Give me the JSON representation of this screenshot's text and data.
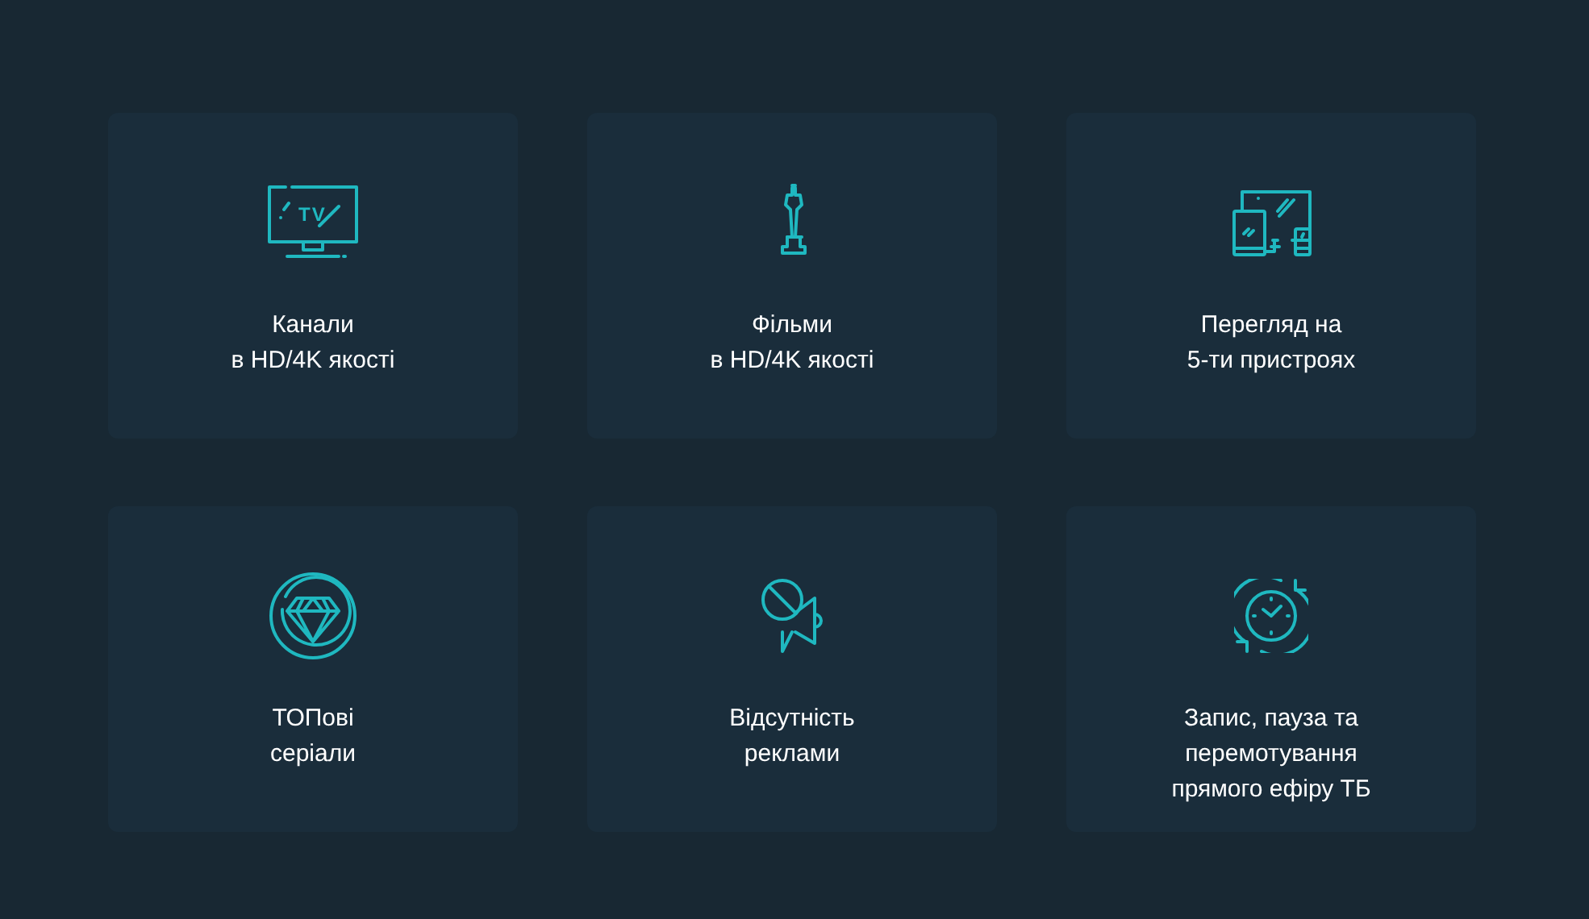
{
  "features": [
    {
      "icon_text": "TV",
      "text": "Канали\nв HD/4K якості"
    },
    {
      "text": "Фільми\nв HD/4K якості"
    },
    {
      "text": "Перегляд на\n5-ти пристроях"
    },
    {
      "text": "ТОПові\nсеріали"
    },
    {
      "text": "Відсутність\nреклами"
    },
    {
      "text": "Запис, пауза та\nперемотування\nпрямого ефіру ТБ"
    }
  ]
}
